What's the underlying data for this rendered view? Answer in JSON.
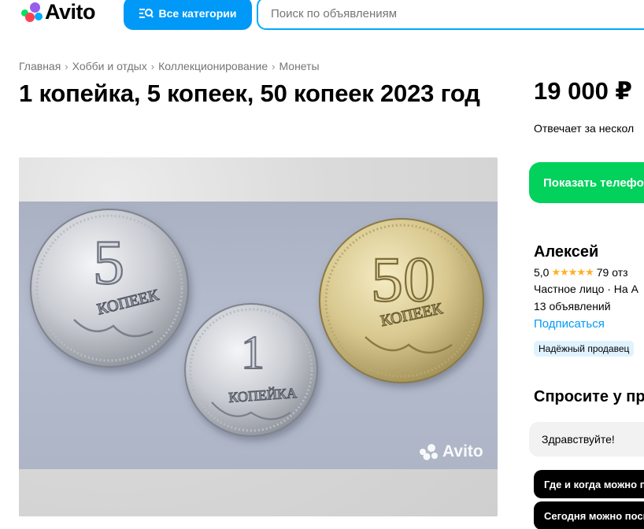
{
  "header": {
    "logo_text": "Avito",
    "categories_label": "Все категории",
    "search_placeholder": "Поиск по объявлениям"
  },
  "breadcrumbs": [
    "Главная",
    "Хобби и отдых",
    "Коллекционирование",
    "Монеты"
  ],
  "title": "1 копейка, 5 копеек, 50 копеек 2023 год",
  "gallery": {
    "watermark": "Avito",
    "coins": [
      {
        "numeral": "5",
        "word": "КОПЕЕК",
        "metal": "silver"
      },
      {
        "numeral": "1",
        "word": "КОПЕЙКА",
        "metal": "silver"
      },
      {
        "numeral": "50",
        "word": "КОПЕЕК",
        "metal": "gold"
      }
    ]
  },
  "sidebar": {
    "price": "19 000 ₽",
    "reply_time": "Отвечает за нескол",
    "show_phone": "Показать телефон",
    "seller": {
      "name": "Алексей",
      "rating": "5,0",
      "stars": "★★★★★",
      "reviews": "79 отз",
      "type": "Частное лицо · На А",
      "ads": "13 объявлений",
      "subscribe": "Подписаться",
      "badge": "Надёжный продавец"
    },
    "ask": {
      "title": "Спросите у пр",
      "message": "Здравствуйте!",
      "quick_questions": [
        "Где и когда можно по",
        "Сегодня можно посм"
      ]
    }
  },
  "colors": {
    "accent_blue": "#0099f7",
    "phone_green": "#02d15c",
    "star": "#ffb021",
    "badge_bg": "#dff3ff"
  }
}
